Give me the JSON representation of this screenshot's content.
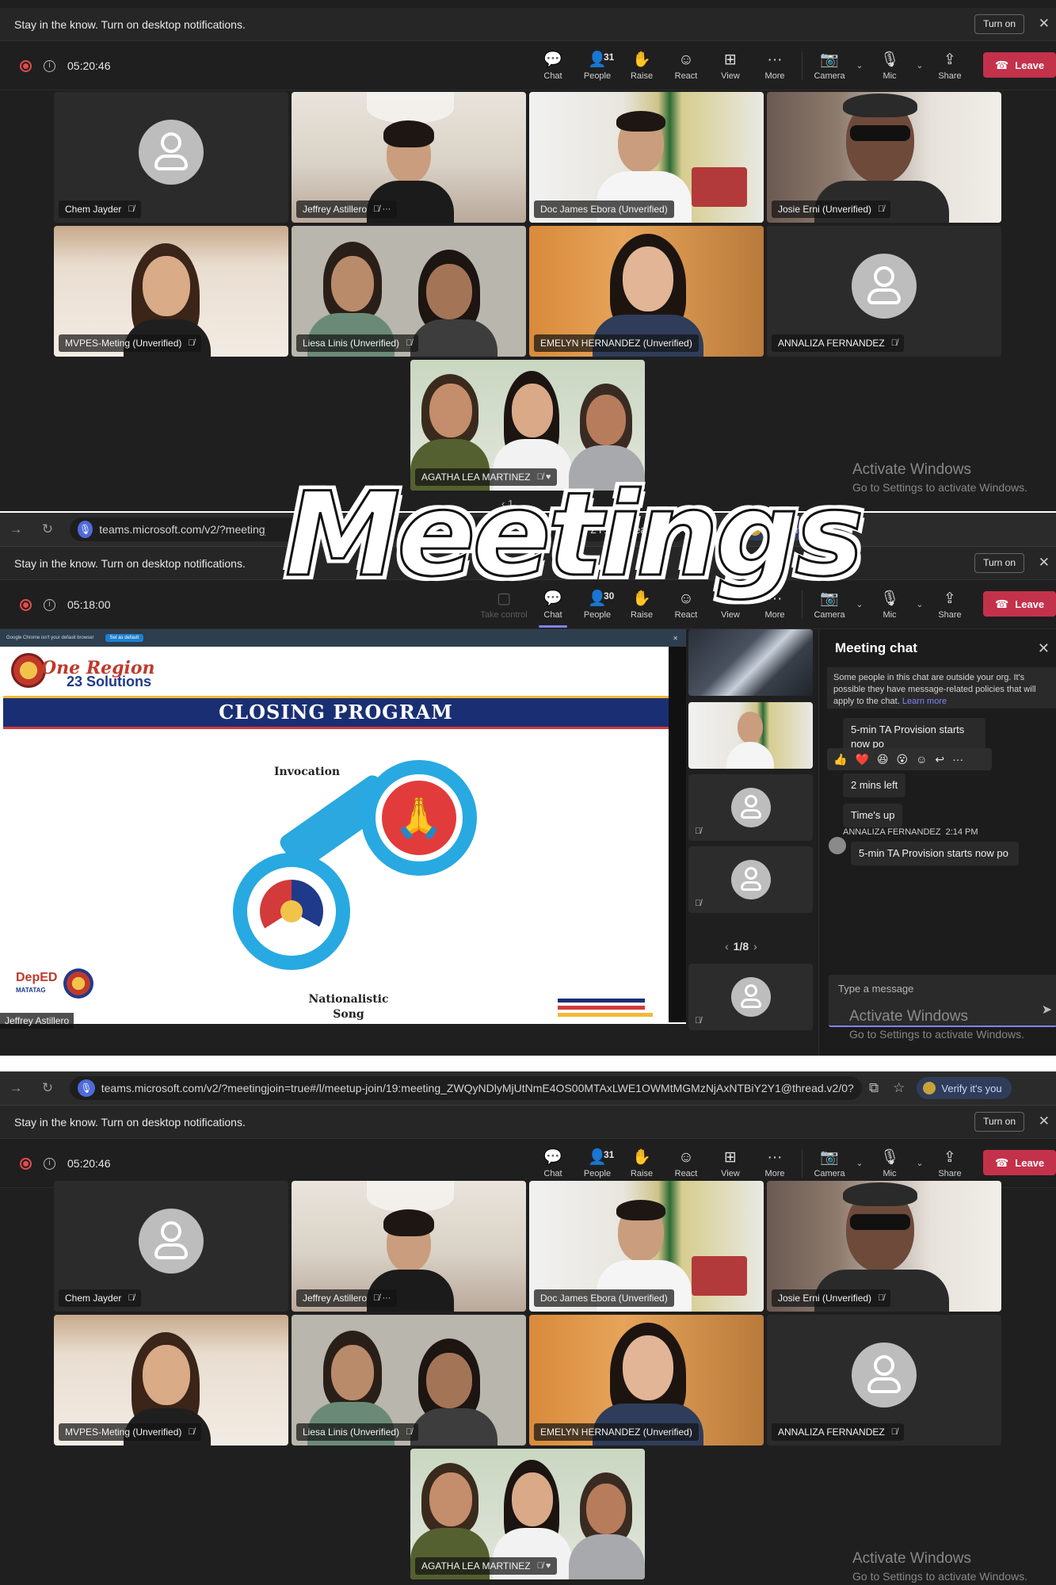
{
  "overlay": {
    "title": "Meetings"
  },
  "browser": {
    "url_short": "teams.microsoft.com/v2/?meetingjoin=",
    "url_short_tail": "2Y1@thread.v2/0?...",
    "url_full": "teams.microsoft.com/v2/?meetingjoin=true#/l/meetup-join/19:meeting_ZWQyNDlyMjUtNmE4OS00MTAxLWE1OWMtMGMzNjAxNTBiY2Y1@thread.v2/0?...",
    "verify_label": "Verify it's you"
  },
  "notification": {
    "text": "Stay in the know. Turn on desktop notifications.",
    "button": "Turn on"
  },
  "toolbar": {
    "timer_1": "05:20:46",
    "timer_2": "05:18:00",
    "timer_3": "05:20:46",
    "take_control": "Take control",
    "chat": "Chat",
    "people": "People",
    "people_count_1": "31",
    "people_count_2": "30",
    "people_count_3": "31",
    "raise": "Raise",
    "react": "React",
    "view": "View",
    "more": "More",
    "camera": "Camera",
    "mic": "Mic",
    "share": "Share",
    "leave": "Leave"
  },
  "participants": [
    {
      "name": "Chem Jayder",
      "type": "avatar"
    },
    {
      "name": "Jeffrey Astillero",
      "type": "video"
    },
    {
      "name": "Doc James Ebora (Unverified)",
      "type": "video"
    },
    {
      "name": "Josie Erni (Unverified)",
      "type": "video"
    },
    {
      "name": "MVPES-Meting (Unverified)",
      "type": "video"
    },
    {
      "name": "Liesa Linis (Unverified)",
      "type": "video"
    },
    {
      "name": "EMELYN HERNANDEZ (Unverified)",
      "type": "video",
      "speaking": true
    },
    {
      "name": "ANNALIZA FERNANDEZ",
      "type": "avatar"
    },
    {
      "name": "AGATHA LEA MARTINEZ",
      "type": "video"
    }
  ],
  "page_indicator": "1",
  "windows_watermark": {
    "line1": "Activate Windows",
    "line2": "Go to Settings to activate Windows."
  },
  "shared_screen": {
    "browser_note": "Google Chrome isn't your default browser",
    "browser_note_button": "Set as default",
    "logo_line1": "One Region",
    "logo_line2": "23 Solutions",
    "banner": "CLOSING PROGRAM",
    "item1": "Invocation",
    "item2_line1": "Nationalistic",
    "item2_line2": "Song",
    "deped": "DepED",
    "matatag": "MATATAG",
    "presenter": "Jeffrey Astillero"
  },
  "rail": {
    "pager": "1/8"
  },
  "chat": {
    "title": "Meeting chat",
    "notice": "Some people in this chat are outside your org. It's possible they have message-related policies that will apply to the chat.",
    "learn_more": "Learn more",
    "messages": [
      "5-min TA Provision starts now po",
      "2 mins left",
      "Time's up"
    ],
    "sender": "ANNALIZA FERNANDEZ",
    "sender_time": "2:14 PM",
    "sender_message": "5-min TA Provision starts now po",
    "reactions": [
      "👍",
      "❤️",
      "😆",
      "😮",
      "☺"
    ],
    "placeholder": "Type a message"
  },
  "colors": {
    "accent": "#7f85f5",
    "leave": "#c4314b",
    "banner": "#1a2f73"
  }
}
